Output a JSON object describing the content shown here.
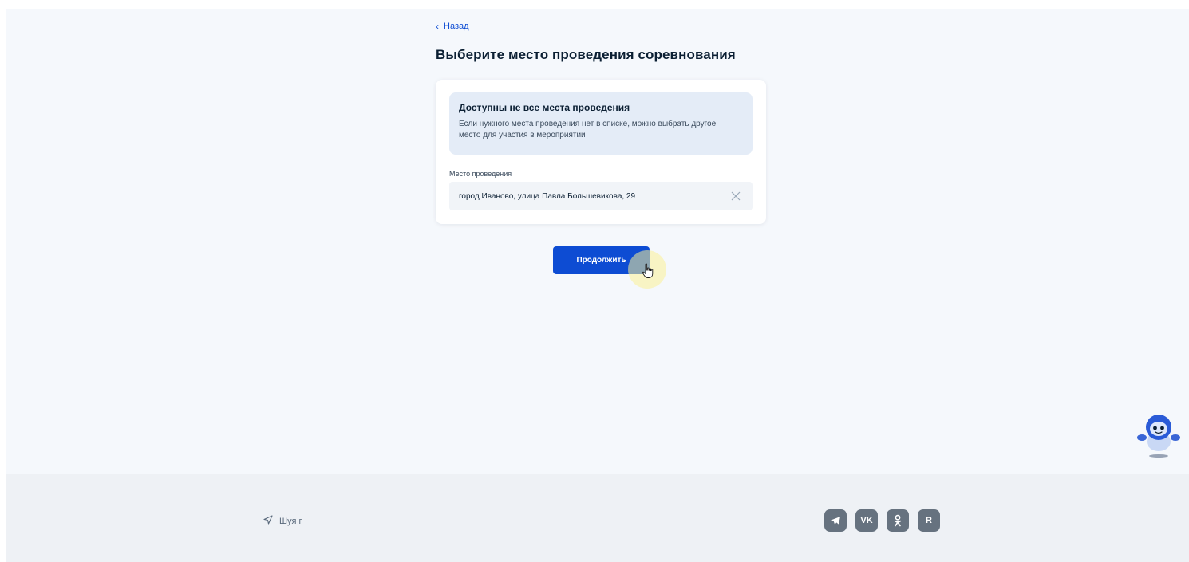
{
  "nav": {
    "back_label": "Назад"
  },
  "page": {
    "title": "Выберите место проведения соревнования"
  },
  "notice": {
    "title": "Доступны не все места проведения",
    "text": "Если нужного места проведения нет в списке, можно выбрать другое место для участия в мероприятии"
  },
  "venue_field": {
    "label": "Место проведения",
    "value": "город Иваново, улица Павла Большевикова, 29"
  },
  "actions": {
    "continue_label": "Продолжить"
  },
  "footer": {
    "location": "Шуя г",
    "socials": [
      {
        "name": "telegram-icon"
      },
      {
        "name": "vk-icon",
        "glyph": "VK"
      },
      {
        "name": "odnoklassniki-icon"
      },
      {
        "name": "rutube-icon",
        "glyph": "R"
      }
    ]
  },
  "colors": {
    "accent": "#0d4cd3",
    "background": "#f5f8fc",
    "notice_bg": "#e4ecf7",
    "footer_bg": "#eef1f5",
    "social_bg": "#66727f"
  }
}
